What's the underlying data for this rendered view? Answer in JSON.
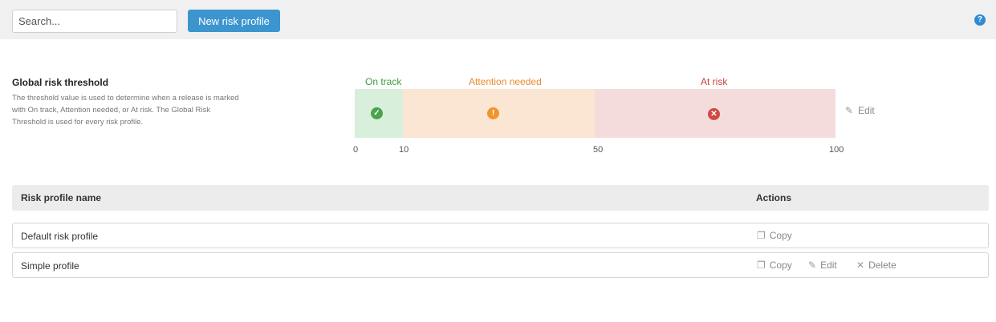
{
  "toolbar": {
    "search_placeholder": "Search...",
    "new_button_label": "New risk profile",
    "help_glyph": "?"
  },
  "threshold": {
    "title": "Global risk threshold",
    "description": "The threshold value is used to determine when a release is marked with On track, Attention needed, or At risk. The Global Risk Threshold is used for every risk profile.",
    "zones": [
      {
        "label": "On track",
        "from": 0,
        "to": 10,
        "color": "#3f9a3f",
        "icon": "check-circle-icon"
      },
      {
        "label": "Attention needed",
        "from": 10,
        "to": 50,
        "color": "#e88a2e",
        "icon": "exclamation-circle-icon"
      },
      {
        "label": "At risk",
        "from": 50,
        "to": 100,
        "color": "#c9413b",
        "icon": "x-circle-icon"
      }
    ],
    "ticks": [
      "0",
      "10",
      "50",
      "100"
    ],
    "edit_label": "Edit"
  },
  "table": {
    "headers": {
      "name": "Risk profile name",
      "actions": "Actions"
    },
    "rows": [
      {
        "name": "Default risk profile",
        "actions": [
          "Copy"
        ]
      },
      {
        "name": "Simple profile",
        "actions": [
          "Copy",
          "Edit",
          "Delete"
        ]
      }
    ]
  },
  "icons": {
    "copy": "copy-icon",
    "edit": "pencil-icon",
    "delete": "close-icon"
  }
}
